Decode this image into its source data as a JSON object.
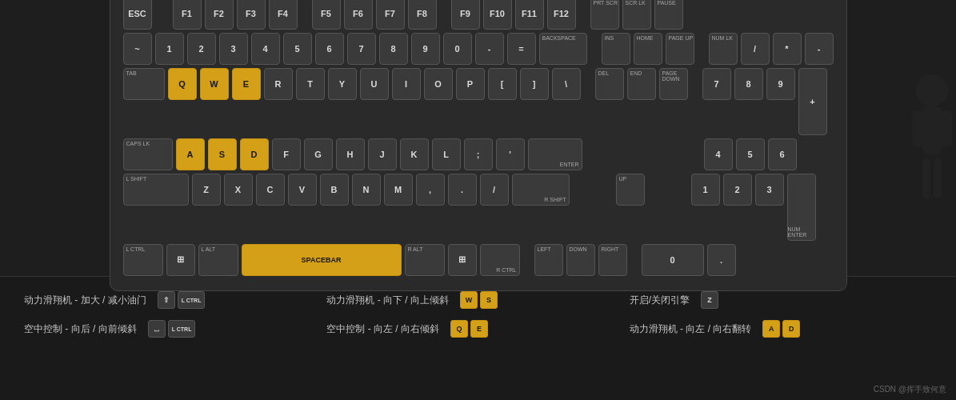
{
  "keyboard": {
    "rows": {
      "r0": [
        "ESC",
        "",
        "F1",
        "F2",
        "F3",
        "F4",
        "",
        "F5",
        "F6",
        "F7",
        "F8",
        "",
        "F9",
        "F10",
        "F11",
        "F12"
      ],
      "r1": [
        "~",
        "1",
        "2",
        "3",
        "4",
        "5",
        "6",
        "7",
        "8",
        "9",
        "0",
        "-",
        "=",
        "BACKSPACE"
      ],
      "r2": [
        "TAB",
        "Q",
        "W",
        "E",
        "R",
        "T",
        "Y",
        "U",
        "I",
        "O",
        "P",
        "[",
        "]",
        "\\"
      ],
      "r3": [
        "CAPS LK",
        "A",
        "S",
        "D",
        "F",
        "G",
        "H",
        "J",
        "K",
        "L",
        ";",
        "'",
        "ENTER"
      ],
      "r4": [
        "L SHIFT",
        "Z",
        "X",
        "C",
        "V",
        "B",
        "N",
        "M",
        ",",
        ".",
        "/",
        "R SHIFT"
      ],
      "r5": [
        "L CTRL",
        "WIN",
        "L ALT",
        "SPACEBAR",
        "R ALT",
        "WIN",
        "R CTRL"
      ]
    },
    "highlighted": [
      "Q",
      "W",
      "E",
      "A",
      "S",
      "D",
      "SPACEBAR"
    ]
  },
  "info_items": [
    {
      "col": 0,
      "rows": [
        {
          "text": "动力滑翔机 - 加大 / 减小油门",
          "keys": [
            {
              "label": "⇧",
              "yellow": false
            },
            {
              "label": "L CTRL",
              "yellow": false,
              "small": true
            }
          ]
        },
        {
          "text": "空中控制 - 向后 / 向前倾斜",
          "keys": [
            {
              "label": "⎵",
              "yellow": false
            },
            {
              "label": "L CTRL",
              "yellow": false,
              "small": true
            }
          ]
        }
      ]
    },
    {
      "col": 1,
      "rows": [
        {
          "text": "动力滑翔机 - 向下 / 向上倾斜",
          "keys": [
            {
              "label": "W",
              "yellow": true
            },
            {
              "label": "S",
              "yellow": true
            }
          ]
        },
        {
          "text": "空中控制 - 向左 / 向右倾斜",
          "keys": [
            {
              "label": "Q",
              "yellow": true
            },
            {
              "label": "E",
              "yellow": true
            }
          ]
        }
      ]
    },
    {
      "col": 2,
      "rows": [
        {
          "text": "开启/关闭引擎",
          "keys": [
            {
              "label": "Z",
              "yellow": false
            }
          ]
        },
        {
          "text": "动力滑翔机 - 向左 / 向右翻转",
          "keys": [
            {
              "label": "A",
              "yellow": true
            },
            {
              "label": "D",
              "yellow": true
            }
          ]
        }
      ]
    }
  ],
  "watermark": "CSDN @挥手致何意"
}
